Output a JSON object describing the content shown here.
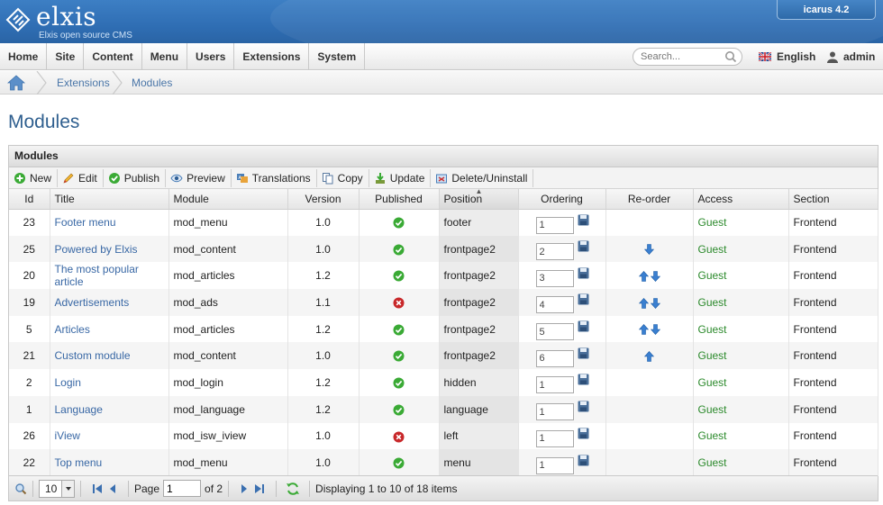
{
  "brand": {
    "name": "elxis",
    "tagline": "Elxis open source CMS",
    "version_label": "icarus 4.2"
  },
  "nav": {
    "items": [
      "Home",
      "Site",
      "Content",
      "Menu",
      "Users",
      "Extensions",
      "System"
    ],
    "search_placeholder": "Search...",
    "language": "English",
    "user": "admin"
  },
  "breadcrumb": {
    "items": [
      "Extensions",
      "Modules"
    ]
  },
  "page_title": "Modules",
  "panel": {
    "title": "Modules",
    "toolbar": [
      "New",
      "Edit",
      "Publish",
      "Preview",
      "Translations",
      "Copy",
      "Update",
      "Delete/Uninstall"
    ],
    "columns": [
      "Id",
      "Title",
      "Module",
      "Version",
      "Published",
      "Position",
      "Ordering",
      "Re-order",
      "Access",
      "Section"
    ],
    "rows": [
      {
        "id": "23",
        "title": "Footer menu",
        "module": "mod_menu",
        "version": "1.0",
        "published": true,
        "position": "footer",
        "ordering": "1",
        "reorder": [],
        "access": "Guest",
        "section": "Frontend"
      },
      {
        "id": "25",
        "title": "Powered by Elxis",
        "module": "mod_content",
        "version": "1.0",
        "published": true,
        "position": "frontpage2",
        "ordering": "2",
        "reorder": [
          "down"
        ],
        "access": "Guest",
        "section": "Frontend"
      },
      {
        "id": "20",
        "title": "The most popular article",
        "module": "mod_articles",
        "version": "1.2",
        "published": true,
        "position": "frontpage2",
        "ordering": "3",
        "reorder": [
          "up",
          "down"
        ],
        "access": "Guest",
        "section": "Frontend"
      },
      {
        "id": "19",
        "title": "Advertisements",
        "module": "mod_ads",
        "version": "1.1",
        "published": false,
        "position": "frontpage2",
        "ordering": "4",
        "reorder": [
          "up",
          "down"
        ],
        "access": "Guest",
        "section": "Frontend"
      },
      {
        "id": "5",
        "title": "Articles",
        "module": "mod_articles",
        "version": "1.2",
        "published": true,
        "position": "frontpage2",
        "ordering": "5",
        "reorder": [
          "up",
          "down"
        ],
        "access": "Guest",
        "section": "Frontend"
      },
      {
        "id": "21",
        "title": "Custom module",
        "module": "mod_content",
        "version": "1.0",
        "published": true,
        "position": "frontpage2",
        "ordering": "6",
        "reorder": [
          "up"
        ],
        "access": "Guest",
        "section": "Frontend"
      },
      {
        "id": "2",
        "title": "Login",
        "module": "mod_login",
        "version": "1.2",
        "published": true,
        "position": "hidden",
        "ordering": "1",
        "reorder": [],
        "access": "Guest",
        "section": "Frontend"
      },
      {
        "id": "1",
        "title": "Language",
        "module": "mod_language",
        "version": "1.2",
        "published": true,
        "position": "language",
        "ordering": "1",
        "reorder": [],
        "access": "Guest",
        "section": "Frontend"
      },
      {
        "id": "26",
        "title": "iView",
        "module": "mod_isw_iview",
        "version": "1.0",
        "published": false,
        "position": "left",
        "ordering": "1",
        "reorder": [],
        "access": "Guest",
        "section": "Frontend"
      },
      {
        "id": "22",
        "title": "Top menu",
        "module": "mod_menu",
        "version": "1.0",
        "published": true,
        "position": "menu",
        "ordering": "1",
        "reorder": [],
        "access": "Guest",
        "section": "Frontend"
      }
    ]
  },
  "pager": {
    "per_page": "10",
    "page_label": "Page",
    "page_value": "1",
    "of_label": "of 2",
    "status": "Displaying 1 to 10 of 18 items"
  },
  "colors": {
    "header_blue": "#2f6eb4",
    "link": "#3968a5",
    "guest_green": "#2c8a2c",
    "published": "#3aaa35",
    "unpublished": "#c8282a"
  }
}
